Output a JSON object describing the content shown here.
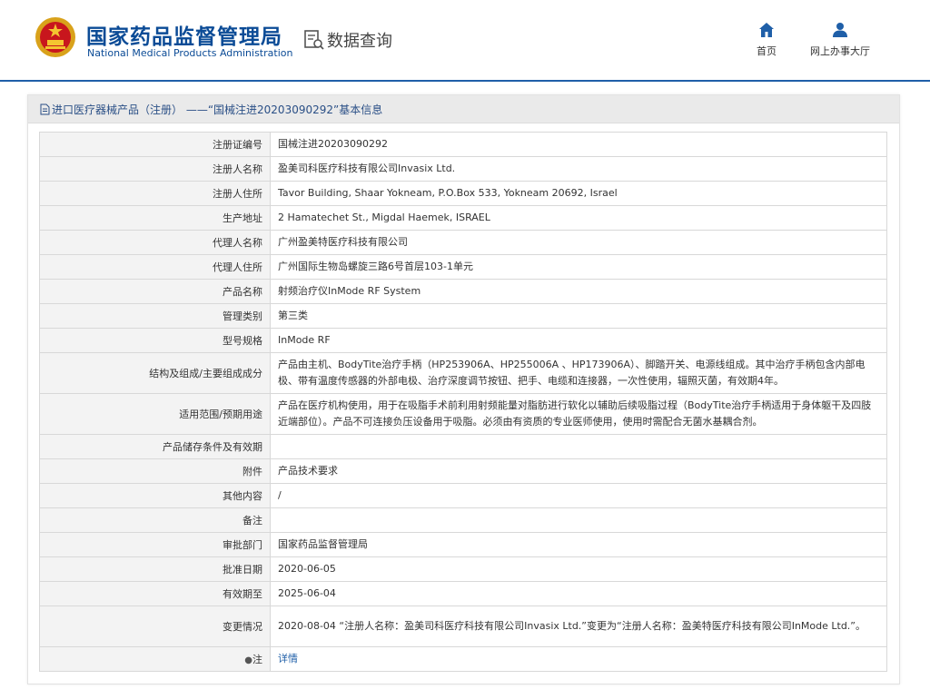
{
  "header": {
    "brand_cn": "国家药品监督管理局",
    "brand_en": "National Medical Products Administration",
    "query_title": "数据查询",
    "nav": [
      {
        "label": "首页",
        "icon": "home-icon"
      },
      {
        "label": "网上办事大厅",
        "icon": "user-icon"
      }
    ]
  },
  "panel": {
    "title": "进口医疗器械产品（注册） ——“国械注进20203090292”基本信息"
  },
  "rows": [
    {
      "key": "注册证编号",
      "value": "国械注进20203090292"
    },
    {
      "key": "注册人名称",
      "value": "盈美司科医疗科技有限公司Invasix Ltd."
    },
    {
      "key": "注册人住所",
      "value": "Tavor Building, Shaar Yokneam, P.O.Box 533, Yokneam 20692, Israel"
    },
    {
      "key": "生产地址",
      "value": "2 Hamatechet St., Migdal Haemek, ISRAEL"
    },
    {
      "key": "代理人名称",
      "value": "广州盈美特医疗科技有限公司"
    },
    {
      "key": "代理人住所",
      "value": "广州国际生物岛螺旋三路6号首层103-1单元"
    },
    {
      "key": "产品名称",
      "value": "射频治疗仪InMode RF System"
    },
    {
      "key": "管理类别",
      "value": "第三类"
    },
    {
      "key": "型号规格",
      "value": "InMode RF"
    },
    {
      "key": "结构及组成/主要组成成分",
      "value": "产品由主机、BodyTite治疗手柄（HP253906A、HP255006A 、HP173906A）、脚踏开关、电源线组成。其中治疗手柄包含内部电极、带有温度传感器的外部电极、治疗深度调节按钮、把手、电缆和连接器，一次性使用，辐照灭菌，有效期4年。"
    },
    {
      "key": "适用范围/预期用途",
      "value": "产品在医疗机构使用，用于在吸脂手术前利用射频能量对脂肪进行软化以辅助后续吸脂过程（BodyTite治疗手柄适用于身体躯干及四肢近端部位）。产品不可连接负压设备用于吸脂。必须由有资质的专业医师使用，使用时需配合无菌水基耦合剂。"
    },
    {
      "key": "产品储存条件及有效期",
      "value": ""
    },
    {
      "key": "附件",
      "value": "产品技术要求"
    },
    {
      "key": "其他内容",
      "value": "/"
    },
    {
      "key": "备注",
      "value": ""
    },
    {
      "key": "审批部门",
      "value": "国家药品监督管理局"
    },
    {
      "key": "批准日期",
      "value": "2020-06-05"
    },
    {
      "key": "有效期至",
      "value": "2025-06-04"
    },
    {
      "key": "变更情况",
      "value": "2020-08-04 “注册人名称：盈美司科医疗科技有限公司Invasix Ltd.”变更为“注册人名称：盈美特医疗科技有限公司InMode Ltd.”。"
    },
    {
      "key": "注",
      "value": "详情"
    }
  ]
}
